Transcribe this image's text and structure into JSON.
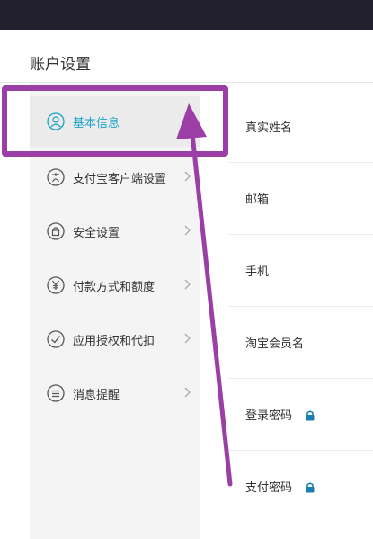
{
  "page": {
    "title": "账户设置"
  },
  "sidebar": {
    "items": [
      {
        "label": "基本信息",
        "icon": "user-icon",
        "active": true
      },
      {
        "label": "支付宝客户端设置",
        "icon": "client-settings-icon"
      },
      {
        "label": "安全设置",
        "icon": "lock-circle-icon"
      },
      {
        "label": "付款方式和额度",
        "icon": "yuan-icon"
      },
      {
        "label": "应用授权和代扣",
        "icon": "check-circle-icon"
      },
      {
        "label": "消息提醒",
        "icon": "message-icon"
      }
    ]
  },
  "fields": [
    {
      "label": "真实姓名"
    },
    {
      "label": "邮箱"
    },
    {
      "label": "手机"
    },
    {
      "label": "淘宝会员名"
    },
    {
      "label": "登录密码",
      "locked": true
    },
    {
      "label": "支付密码",
      "locked": true
    }
  ],
  "annotation": {
    "color": "#9b3fa6"
  },
  "colors": {
    "accent": "#1aa3c8",
    "topbar": "#211f2b"
  }
}
